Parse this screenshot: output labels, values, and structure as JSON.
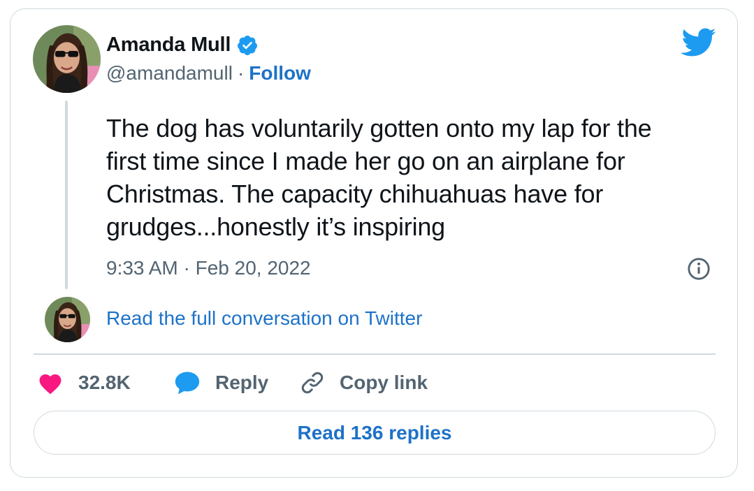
{
  "author": {
    "name": "Amanda Mull",
    "handle": "@amandamull",
    "separator": "·",
    "follow_label": "Follow",
    "verified": true
  },
  "tweet": {
    "text_lines": [
      "The dog has voluntarily gotten onto my lap for the",
      "first time since I made her go on an airplane for",
      "Christmas. The capacity chihuahuas have for",
      "grudges...honestly it’s inspiring"
    ],
    "timestamp": "9:33 AM · Feb 20, 2022"
  },
  "conversation_link": "Read the full conversation on Twitter",
  "actions": {
    "like_count": "32.8K",
    "reply_label": "Reply",
    "copy_link_label": "Copy link"
  },
  "read_replies_label": "Read 136 replies",
  "icons": {
    "twitter_logo": "twitter-bird-icon",
    "verified": "verified-badge-icon",
    "info": "info-icon",
    "like": "heart-icon",
    "reply": "speech-bubble-icon",
    "copy_link": "link-icon"
  },
  "colors": {
    "accent": "#1d9bf0",
    "link": "#1d72c8",
    "like": "#f91880",
    "text": "#0f1419",
    "muted": "#536471",
    "border": "#cfd9de"
  }
}
